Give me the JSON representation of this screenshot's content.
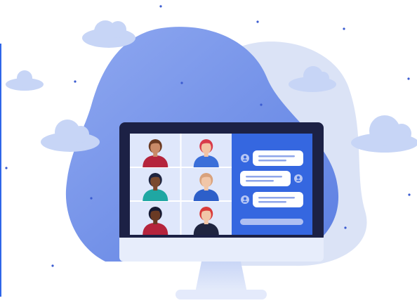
{
  "illustration": {
    "subject": "video-conference",
    "participants": [
      {
        "name": "participant-1",
        "skin": "#c98a68",
        "hair": "#6b3a22",
        "shirt": "#b5243c"
      },
      {
        "name": "participant-2",
        "skin": "#f2c3a4",
        "hair": "#d83a4a",
        "shirt": "#3b6fd9"
      },
      {
        "name": "participant-3",
        "skin": "#7a4a2e",
        "hair": "#1f2540",
        "shirt": "#1fa7a3"
      },
      {
        "name": "participant-4",
        "skin": "#f1c6a8",
        "hair": "#d9a27c",
        "shirt": "#2d5fc9"
      },
      {
        "name": "participant-5",
        "skin": "#6a3a24",
        "hair": "#161a33",
        "shirt": "#b5243c"
      },
      {
        "name": "participant-6",
        "skin": "#f1c6a8",
        "hair": "#d93a3a",
        "shirt": "#1f2540"
      }
    ],
    "chat_messages": [
      {
        "side": "left"
      },
      {
        "side": "right"
      },
      {
        "side": "left"
      }
    ],
    "colors": {
      "blob_main": "#6f8ee8",
      "blob_back": "#dbe3f6",
      "cloud": "#c7d5f6",
      "monitor_frame": "#1c2145",
      "screen_bg": "#dfe7fb",
      "chat_panel": "#3567e0",
      "accent": "#2f66e8"
    }
  }
}
